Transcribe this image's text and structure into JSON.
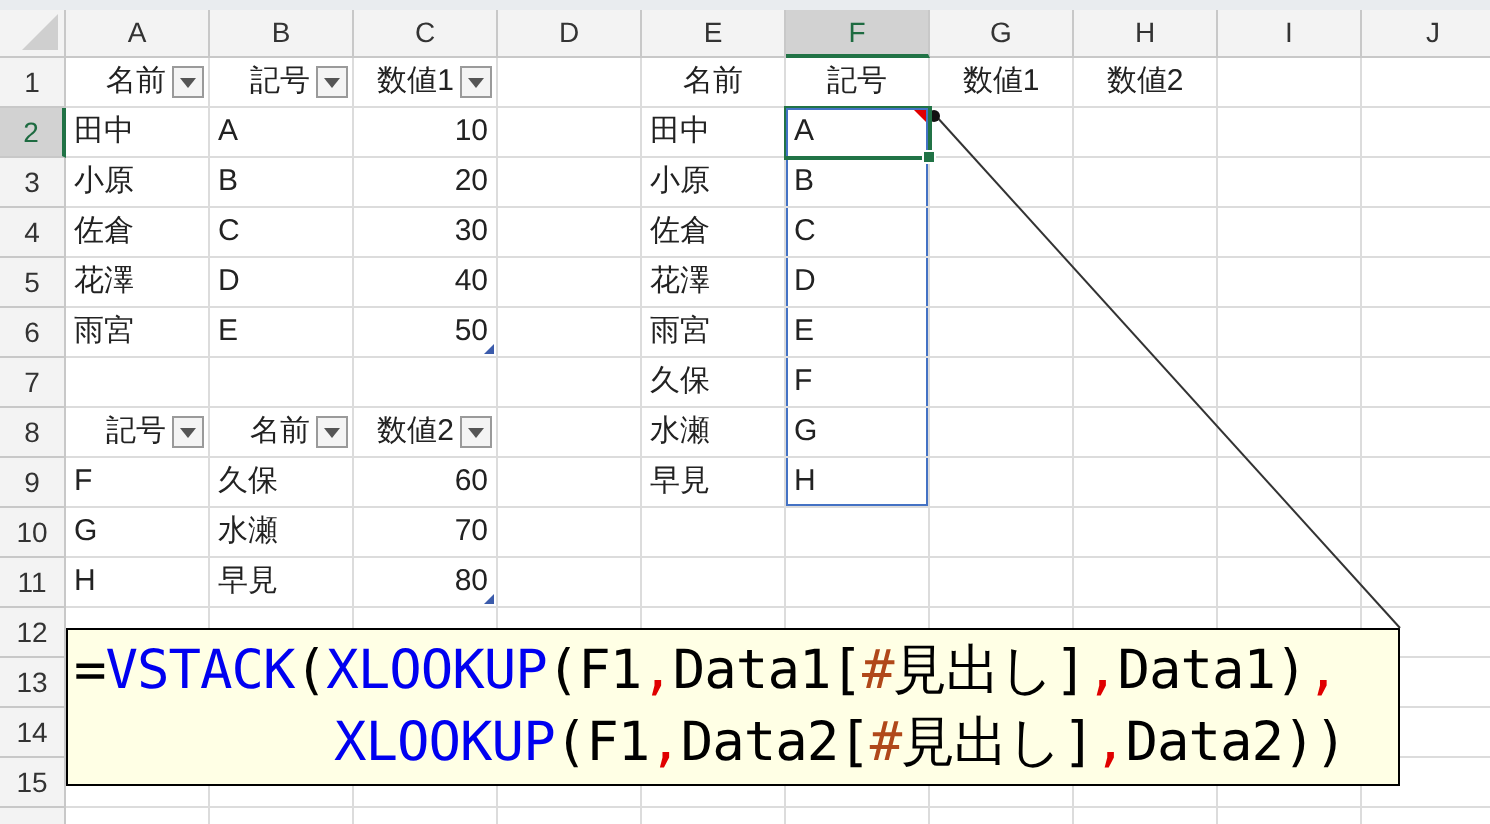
{
  "columns": [
    {
      "label": "A",
      "selected": false
    },
    {
      "label": "B",
      "selected": false
    },
    {
      "label": "C",
      "selected": false
    },
    {
      "label": "D",
      "selected": false
    },
    {
      "label": "E",
      "selected": false
    },
    {
      "label": "F",
      "selected": true
    },
    {
      "label": "G",
      "selected": false
    },
    {
      "label": "H",
      "selected": false
    },
    {
      "label": "I",
      "selected": false
    },
    {
      "label": "J",
      "selected": false
    }
  ],
  "rows": [
    {
      "label": "1",
      "selected": false,
      "cells": [
        {
          "kind": "filter_header",
          "text": "名前",
          "selected": false
        },
        {
          "kind": "filter_header",
          "text": "記号",
          "selected": false
        },
        {
          "kind": "filter_header",
          "text": "数値1",
          "selected": false
        },
        {
          "kind": "empty",
          "selected": false
        },
        {
          "kind": "title",
          "text": "名前",
          "selected": false
        },
        {
          "kind": "title",
          "text": "記号",
          "selected": false
        },
        {
          "kind": "title",
          "text": "数値1",
          "selected": false
        },
        {
          "kind": "title",
          "text": "数値2",
          "selected": false
        },
        {
          "kind": "empty",
          "selected": false
        },
        {
          "kind": "empty",
          "selected": false
        }
      ]
    },
    {
      "label": "2",
      "selected": true,
      "cells": [
        {
          "kind": "text",
          "text": "田中",
          "selected": false
        },
        {
          "kind": "text",
          "text": "A",
          "selected": false
        },
        {
          "kind": "number",
          "text": "10",
          "selected": false
        },
        {
          "kind": "empty",
          "selected": false
        },
        {
          "kind": "text",
          "text": "田中",
          "selected": false
        },
        {
          "kind": "spill_anchor",
          "text": "A",
          "selected": true
        },
        {
          "kind": "empty",
          "selected": false
        },
        {
          "kind": "empty",
          "selected": false
        },
        {
          "kind": "empty",
          "selected": false
        },
        {
          "kind": "empty",
          "selected": false
        }
      ]
    },
    {
      "label": "3",
      "selected": false,
      "cells": [
        {
          "kind": "text",
          "text": "小原",
          "selected": false
        },
        {
          "kind": "text",
          "text": "B",
          "selected": false
        },
        {
          "kind": "number",
          "text": "20",
          "selected": false
        },
        {
          "kind": "empty",
          "selected": false
        },
        {
          "kind": "text",
          "text": "小原",
          "selected": false
        },
        {
          "kind": "spill",
          "text": "B",
          "selected": false
        },
        {
          "kind": "empty",
          "selected": false
        },
        {
          "kind": "empty",
          "selected": false
        },
        {
          "kind": "empty",
          "selected": false
        },
        {
          "kind": "empty",
          "selected": false
        }
      ]
    },
    {
      "label": "4",
      "selected": false,
      "cells": [
        {
          "kind": "text",
          "text": "佐倉",
          "selected": false
        },
        {
          "kind": "text",
          "text": "C",
          "selected": false
        },
        {
          "kind": "number",
          "text": "30",
          "selected": false
        },
        {
          "kind": "empty",
          "selected": false
        },
        {
          "kind": "text",
          "text": "佐倉",
          "selected": false
        },
        {
          "kind": "spill",
          "text": "C",
          "selected": false
        },
        {
          "kind": "empty",
          "selected": false
        },
        {
          "kind": "empty",
          "selected": false
        },
        {
          "kind": "empty",
          "selected": false
        },
        {
          "kind": "empty",
          "selected": false
        }
      ]
    },
    {
      "label": "5",
      "selected": false,
      "cells": [
        {
          "kind": "text",
          "text": "花澤",
          "selected": false
        },
        {
          "kind": "text",
          "text": "D",
          "selected": false
        },
        {
          "kind": "number",
          "text": "40",
          "selected": false
        },
        {
          "kind": "empty",
          "selected": false
        },
        {
          "kind": "text",
          "text": "花澤",
          "selected": false
        },
        {
          "kind": "spill",
          "text": "D",
          "selected": false
        },
        {
          "kind": "empty",
          "selected": false
        },
        {
          "kind": "empty",
          "selected": false
        },
        {
          "kind": "empty",
          "selected": false
        },
        {
          "kind": "empty",
          "selected": false
        }
      ]
    },
    {
      "label": "6",
      "selected": false,
      "cells": [
        {
          "kind": "text",
          "text": "雨宮",
          "selected": false
        },
        {
          "kind": "text",
          "text": "E",
          "selected": false
        },
        {
          "kind": "number_end",
          "text": "50",
          "selected": false
        },
        {
          "kind": "empty",
          "selected": false
        },
        {
          "kind": "text",
          "text": "雨宮",
          "selected": false
        },
        {
          "kind": "spill",
          "text": "E",
          "selected": false
        },
        {
          "kind": "empty",
          "selected": false
        },
        {
          "kind": "empty",
          "selected": false
        },
        {
          "kind": "empty",
          "selected": false
        },
        {
          "kind": "empty",
          "selected": false
        }
      ]
    },
    {
      "label": "7",
      "selected": false,
      "cells": [
        {
          "kind": "empty",
          "selected": false
        },
        {
          "kind": "empty",
          "selected": false
        },
        {
          "kind": "empty",
          "selected": false
        },
        {
          "kind": "empty",
          "selected": false
        },
        {
          "kind": "text",
          "text": "久保",
          "selected": false
        },
        {
          "kind": "spill",
          "text": "F",
          "selected": false
        },
        {
          "kind": "empty",
          "selected": false
        },
        {
          "kind": "empty",
          "selected": false
        },
        {
          "kind": "empty",
          "selected": false
        },
        {
          "kind": "empty",
          "selected": false
        }
      ]
    },
    {
      "label": "8",
      "selected": false,
      "cells": [
        {
          "kind": "filter_header",
          "text": "記号",
          "selected": false
        },
        {
          "kind": "filter_header",
          "text": "名前",
          "selected": false
        },
        {
          "kind": "filter_header",
          "text": "数値2",
          "selected": false
        },
        {
          "kind": "empty",
          "selected": false
        },
        {
          "kind": "text",
          "text": "水瀬",
          "selected": false
        },
        {
          "kind": "spill",
          "text": "G",
          "selected": false
        },
        {
          "kind": "empty",
          "selected": false
        },
        {
          "kind": "empty",
          "selected": false
        },
        {
          "kind": "empty",
          "selected": false
        },
        {
          "kind": "empty",
          "selected": false
        }
      ]
    },
    {
      "label": "9",
      "selected": false,
      "cells": [
        {
          "kind": "text",
          "text": "F",
          "selected": false
        },
        {
          "kind": "text",
          "text": "久保",
          "selected": false
        },
        {
          "kind": "number",
          "text": "60",
          "selected": false
        },
        {
          "kind": "empty",
          "selected": false
        },
        {
          "kind": "text",
          "text": "早見",
          "selected": false
        },
        {
          "kind": "spill",
          "text": "H",
          "selected": false
        },
        {
          "kind": "empty",
          "selected": false
        },
        {
          "kind": "empty",
          "selected": false
        },
        {
          "kind": "empty",
          "selected": false
        },
        {
          "kind": "empty",
          "selected": false
        }
      ]
    },
    {
      "label": "10",
      "selected": false,
      "cells": [
        {
          "kind": "text",
          "text": "G",
          "selected": false
        },
        {
          "kind": "text",
          "text": "水瀬",
          "selected": false
        },
        {
          "kind": "number",
          "text": "70",
          "selected": false
        },
        {
          "kind": "empty",
          "selected": false
        },
        {
          "kind": "empty",
          "selected": false
        },
        {
          "kind": "empty",
          "selected": false
        },
        {
          "kind": "empty",
          "selected": false
        },
        {
          "kind": "empty",
          "selected": false
        },
        {
          "kind": "empty",
          "selected": false
        },
        {
          "kind": "empty",
          "selected": false
        }
      ]
    },
    {
      "label": "11",
      "selected": false,
      "cells": [
        {
          "kind": "text",
          "text": "H",
          "selected": false
        },
        {
          "kind": "text",
          "text": "早見",
          "selected": false
        },
        {
          "kind": "number_end",
          "text": "80",
          "selected": false
        },
        {
          "kind": "empty",
          "selected": false
        },
        {
          "kind": "empty",
          "selected": false
        },
        {
          "kind": "empty",
          "selected": false
        },
        {
          "kind": "empty",
          "selected": false
        },
        {
          "kind": "empty",
          "selected": false
        },
        {
          "kind": "empty",
          "selected": false
        },
        {
          "kind": "empty",
          "selected": false
        }
      ]
    },
    {
      "label": "12",
      "selected": false,
      "cells": [
        {
          "kind": "empty",
          "selected": false
        },
        {
          "kind": "empty",
          "selected": false
        },
        {
          "kind": "empty",
          "selected": false
        },
        {
          "kind": "empty",
          "selected": false
        },
        {
          "kind": "empty",
          "selected": false
        },
        {
          "kind": "empty",
          "selected": false
        },
        {
          "kind": "empty",
          "selected": false
        },
        {
          "kind": "empty",
          "selected": false
        },
        {
          "kind": "empty",
          "selected": false
        },
        {
          "kind": "empty",
          "selected": false
        }
      ]
    },
    {
      "label": "13",
      "selected": false
    },
    {
      "label": "14",
      "selected": false
    },
    {
      "label": "15",
      "selected": false,
      "cells": [
        {
          "kind": "empty",
          "selected": false
        },
        {
          "kind": "empty",
          "selected": false
        },
        {
          "kind": "empty",
          "selected": false
        },
        {
          "kind": "empty",
          "selected": false
        },
        {
          "kind": "empty",
          "selected": false
        },
        {
          "kind": "empty",
          "selected": false
        },
        {
          "kind": "empty",
          "selected": false
        },
        {
          "kind": "empty",
          "selected": false
        },
        {
          "kind": "empty",
          "selected": false
        },
        {
          "kind": "empty",
          "selected": false
        }
      ]
    }
  ],
  "callout": {
    "lines": [
      {
        "continuation": false,
        "tokens": [
          {
            "kind": "plain",
            "text": "="
          },
          {
            "kind": "function",
            "text": "VSTACK"
          },
          {
            "kind": "plain",
            "text": "("
          },
          {
            "kind": "function",
            "text": "XLOOKUP"
          },
          {
            "kind": "plain",
            "text": "(F1"
          },
          {
            "kind": "separator",
            "text": ","
          },
          {
            "kind": "plain",
            "text": "Data1["
          },
          {
            "kind": "special",
            "text": "#"
          },
          {
            "kind": "plain",
            "text": "見出し]"
          },
          {
            "kind": "separator",
            "text": ","
          },
          {
            "kind": "plain",
            "text": "Data1)"
          },
          {
            "kind": "separator",
            "text": ","
          }
        ]
      },
      {
        "continuation": true,
        "tokens": [
          {
            "kind": "function",
            "text": "XLOOKUP"
          },
          {
            "kind": "plain",
            "text": "(F1"
          },
          {
            "kind": "separator",
            "text": ","
          },
          {
            "kind": "plain",
            "text": "Data2["
          },
          {
            "kind": "special",
            "text": "#"
          },
          {
            "kind": "plain",
            "text": "見出し]"
          },
          {
            "kind": "separator",
            "text": ","
          },
          {
            "kind": "plain",
            "text": "Data2))"
          }
        ]
      }
    ]
  }
}
